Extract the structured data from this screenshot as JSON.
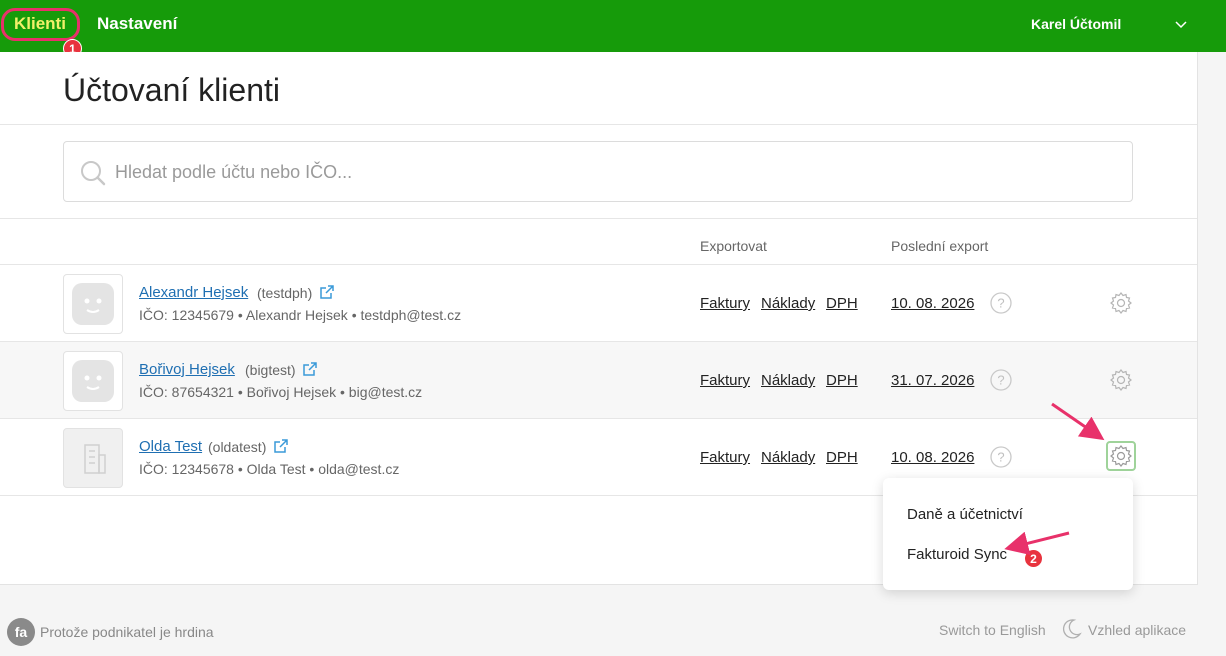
{
  "nav": {
    "clients": "Klienti",
    "settings": "Nastavení",
    "user": "Karel Účtomil"
  },
  "badges": {
    "one": "1",
    "two": "2"
  },
  "page": {
    "title": "Účtovaní klienti"
  },
  "search": {
    "placeholder": "Hledat podle účtu nebo IČO..."
  },
  "columns": {
    "export": "Exportovat",
    "last_export": "Poslední export"
  },
  "export_links": {
    "invoices": "Faktury",
    "costs": "Náklady",
    "vat": "DPH"
  },
  "clients": [
    {
      "name": "Alexandr Hejsek",
      "login": "(testdph)",
      "info": "IČO: 12345679 • Alexandr Hejsek • testdph@test.cz",
      "last_export": "10. 08. 2026"
    },
    {
      "name": "Bořivoj Hejsek",
      "login": "(bigtest)",
      "info": "IČO: 87654321 • Bořivoj Hejsek • big@test.cz",
      "last_export": "31. 07. 2026"
    },
    {
      "name": "Olda Test",
      "login": "(oldatest)",
      "info": "IČO: 12345678 • Olda Test • olda@test.cz",
      "last_export": "10. 08. 2026"
    }
  ],
  "settings_menu": {
    "items": [
      "Daně a účetnictví",
      "Fakturoid Sync"
    ]
  },
  "footer": {
    "tagline": "Protože podnikatel je hrdina",
    "language": "Switch to English",
    "theme": "Vzhled aplikace",
    "logo_text": "fa"
  },
  "colors": {
    "topbar": "#169b0a",
    "active_nav": "#f2f06a",
    "link": "#1f6fb2",
    "annotation": "#e8316a"
  }
}
